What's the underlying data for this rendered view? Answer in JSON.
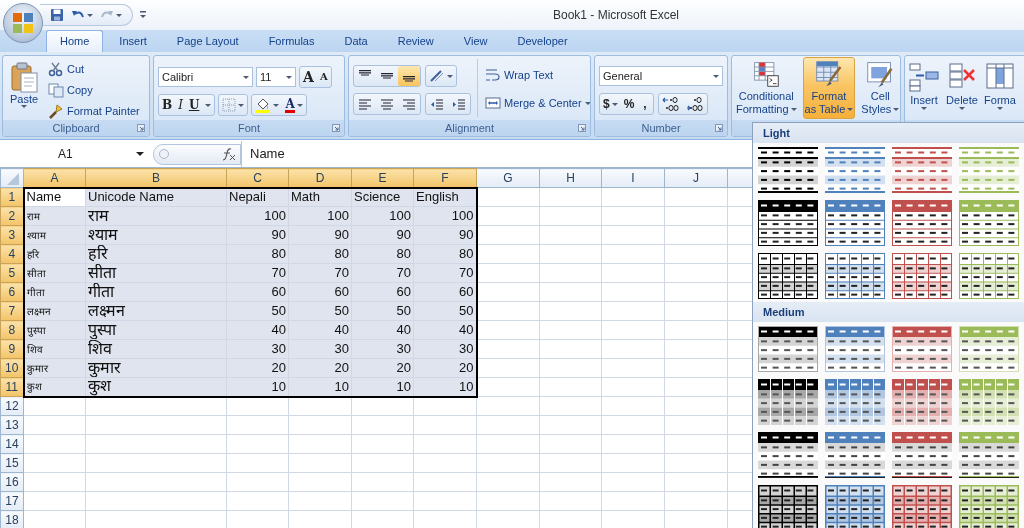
{
  "window": {
    "title": "Book1 - Microsoft Excel"
  },
  "tabs": [
    {
      "label": "Home",
      "selected": true
    },
    {
      "label": "Insert",
      "selected": false
    },
    {
      "label": "Page Layout",
      "selected": false
    },
    {
      "label": "Formulas",
      "selected": false
    },
    {
      "label": "Data",
      "selected": false
    },
    {
      "label": "Review",
      "selected": false
    },
    {
      "label": "View",
      "selected": false
    },
    {
      "label": "Developer",
      "selected": false
    }
  ],
  "ribbon": {
    "clipboard": {
      "label": "Clipboard",
      "paste": "Paste",
      "cut": "Cut",
      "copy": "Copy",
      "format_painter": "Format Painter"
    },
    "font": {
      "label": "Font",
      "font_name": "Calibri",
      "font_size": "11",
      "grow_font": "A",
      "shrink_font": "A",
      "bold": "B",
      "italic": "I",
      "underline": "U",
      "font_color": "A"
    },
    "alignment": {
      "label": "Alignment",
      "vertical": [
        {
          "kind": "top",
          "selected": false
        },
        {
          "kind": "middle",
          "selected": false
        },
        {
          "kind": "bottom",
          "selected": true
        }
      ],
      "wrap_text": "Wrap Text",
      "merge_center": "Merge & Center"
    },
    "number": {
      "label": "Number",
      "format": "General",
      "currency": "$",
      "percent": "%",
      "comma": ","
    },
    "styles": {
      "conditional": [
        "Conditional",
        "Formatting"
      ],
      "format_as_table": {
        "lines": [
          "Format",
          "as Table"
        ],
        "selected": true
      },
      "cell_styles": [
        "Cell",
        "Styles"
      ]
    },
    "cells": {
      "insert": "Insert",
      "delete": "Delete",
      "format": "Forma"
    }
  },
  "formula_bar": {
    "name_box": "A1",
    "content": "Name"
  },
  "sheet": {
    "columns": [
      {
        "label": "A",
        "selected": true,
        "kind": "legacy"
      },
      {
        "label": "B",
        "selected": true,
        "kind": "unicode"
      },
      {
        "label": "C",
        "selected": true,
        "kind": "number"
      },
      {
        "label": "D",
        "selected": true,
        "kind": "number"
      },
      {
        "label": "E",
        "selected": true,
        "kind": "number"
      },
      {
        "label": "F",
        "selected": true,
        "kind": "number"
      },
      {
        "label": "G",
        "selected": false
      },
      {
        "label": "H",
        "selected": false
      },
      {
        "label": "I",
        "selected": false
      },
      {
        "label": "J",
        "selected": false
      }
    ],
    "rows": [
      {
        "number": "1",
        "selected": true,
        "kind": "header",
        "cells": [
          "Name",
          "Unicode Name",
          "Nepali",
          "Math",
          "Science",
          "English"
        ]
      },
      {
        "number": "2",
        "selected": true,
        "cells": [
          "राम",
          "राम",
          "100",
          "100",
          "100",
          "100"
        ]
      },
      {
        "number": "3",
        "selected": true,
        "cells": [
          "श्याम",
          "श्याम",
          "90",
          "90",
          "90",
          "90"
        ]
      },
      {
        "number": "4",
        "selected": true,
        "cells": [
          "हरि",
          "हरि",
          "80",
          "80",
          "80",
          "80"
        ]
      },
      {
        "number": "5",
        "selected": true,
        "cells": [
          "सीता",
          "सीता",
          "70",
          "70",
          "70",
          "70"
        ]
      },
      {
        "number": "6",
        "selected": true,
        "cells": [
          "गीता",
          "गीता",
          "60",
          "60",
          "60",
          "60"
        ]
      },
      {
        "number": "7",
        "selected": true,
        "cells": [
          "लक्ष्मन",
          "लक्ष्मन",
          "50",
          "50",
          "50",
          "50"
        ]
      },
      {
        "number": "8",
        "selected": true,
        "cells": [
          "पुस्पा",
          "पुस्पा",
          "40",
          "40",
          "40",
          "40"
        ]
      },
      {
        "number": "9",
        "selected": true,
        "cells": [
          "शिव",
          "शिव",
          "30",
          "30",
          "30",
          "30"
        ]
      },
      {
        "number": "10",
        "selected": true,
        "cells": [
          "कुमार",
          "कुमार",
          "20",
          "20",
          "20",
          "20"
        ]
      },
      {
        "number": "11",
        "selected": true,
        "cells": [
          "कुश",
          "कुश",
          "10",
          "10",
          "10",
          "10"
        ]
      },
      {
        "number": "12",
        "selected": false
      },
      {
        "number": "13",
        "selected": false
      },
      {
        "number": "14",
        "selected": false
      },
      {
        "number": "15",
        "selected": false
      },
      {
        "number": "16",
        "selected": false
      },
      {
        "number": "17",
        "selected": false
      },
      {
        "number": "18",
        "selected": false
      }
    ]
  },
  "gallery": {
    "sections": [
      {
        "title": "Light",
        "styles": [
          {
            "kind": "light-1",
            "color": "#000000"
          },
          {
            "kind": "light-1",
            "color": "#4f81bd"
          },
          {
            "kind": "light-1",
            "color": "#c0504d"
          },
          {
            "kind": "light-1",
            "color": "#9bbb59"
          },
          {
            "kind": "light-2",
            "color": "#000000"
          },
          {
            "kind": "light-2",
            "color": "#4f81bd"
          },
          {
            "kind": "light-2",
            "color": "#c0504d"
          },
          {
            "kind": "light-2",
            "color": "#9bbb59"
          },
          {
            "kind": "light-3",
            "color": "#000000"
          },
          {
            "kind": "light-3",
            "color": "#4f81bd"
          },
          {
            "kind": "light-3",
            "color": "#c0504d"
          },
          {
            "kind": "light-3",
            "color": "#9bbb59"
          }
        ]
      },
      {
        "title": "Medium",
        "styles": [
          {
            "kind": "medium-1",
            "color": "#000000"
          },
          {
            "kind": "medium-1",
            "color": "#4f81bd"
          },
          {
            "kind": "medium-1",
            "color": "#c0504d"
          },
          {
            "kind": "medium-1",
            "color": "#9bbb59"
          },
          {
            "kind": "medium-2",
            "color": "#000000"
          },
          {
            "kind": "medium-2",
            "color": "#4f81bd"
          },
          {
            "kind": "medium-2",
            "color": "#c0504d"
          },
          {
            "kind": "medium-2",
            "color": "#9bbb59"
          },
          {
            "kind": "medium-3",
            "color": "#000000"
          },
          {
            "kind": "medium-3",
            "color": "#4f81bd"
          },
          {
            "kind": "medium-3",
            "color": "#c0504d"
          },
          {
            "kind": "medium-3",
            "color": "#9bbb59"
          },
          {
            "kind": "medium-4",
            "color": "#000000"
          },
          {
            "kind": "medium-4",
            "color": "#4f81bd"
          },
          {
            "kind": "medium-4",
            "color": "#c0504d"
          },
          {
            "kind": "medium-4",
            "color": "#9bbb59"
          }
        ]
      }
    ]
  }
}
